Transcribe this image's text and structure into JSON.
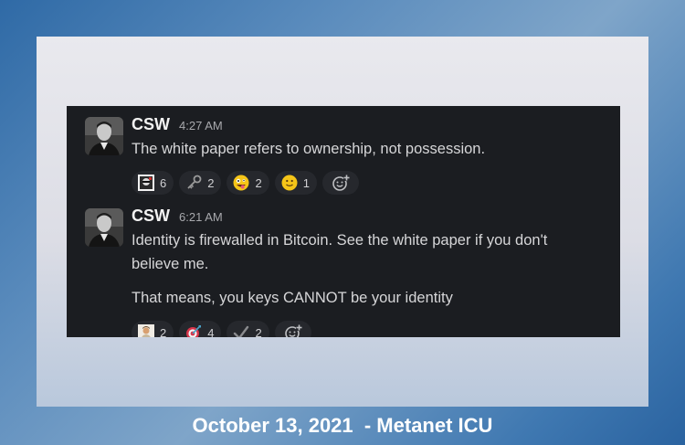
{
  "messages": [
    {
      "author": "CSW",
      "time": "4:27 AM",
      "lines": [
        "The white paper refers to ownership, not possession."
      ],
      "reactions": [
        {
          "icon": "avatar-face-emoji",
          "count": "6"
        },
        {
          "icon": "key-emoji",
          "count": "2"
        },
        {
          "icon": "zany-face-emoji",
          "count": "2"
        },
        {
          "icon": "slight-smile-emoji",
          "count": "1"
        }
      ],
      "add_reaction_icon": "add-reaction-icon"
    },
    {
      "author": "CSW",
      "time": "6:21 AM",
      "lines": [
        "Identity is firewalled in Bitcoin. See the white paper if you don't",
        "believe me.",
        "That means, you keys CANNOT be your identity"
      ],
      "reactions": [
        {
          "icon": "portrait-emoji",
          "count": "2"
        },
        {
          "icon": "dart-emoji",
          "count": "4"
        },
        {
          "icon": "check-mark-emoji",
          "count": "2"
        }
      ],
      "add_reaction_icon": "add-reaction-icon"
    }
  ],
  "caption": "October 13, 2021  - Metanet ICU",
  "colors": {
    "chat_bg": "#1b1d21",
    "pill_bg": "#26282d",
    "frame_bg": "#e6e6ec",
    "page_bg": "#3f78b1"
  }
}
